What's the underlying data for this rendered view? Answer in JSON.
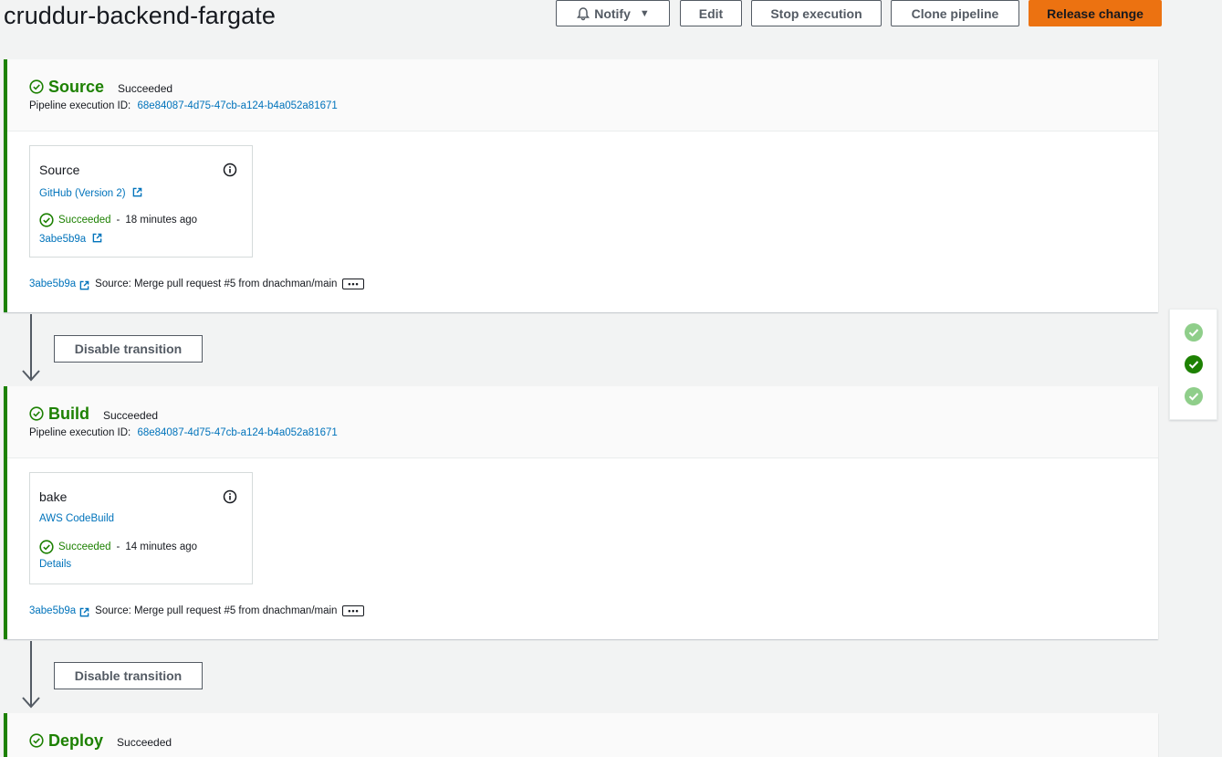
{
  "page": {
    "title": "cruddur-backend-fargate"
  },
  "toolbar": {
    "notify_label": "Notify",
    "edit_label": "Edit",
    "stop_label": "Stop execution",
    "clone_label": "Clone pipeline",
    "release_label": "Release change",
    "accent": "#ec7211"
  },
  "stages": [
    {
      "name": "Source",
      "status": "Succeeded",
      "exec_label": "Pipeline execution ID:",
      "exec_id": "68e84087-4d75-47cb-a124-b4a052a81671",
      "action": {
        "name": "Source",
        "provider": "GitHub (Version 2)",
        "status": "Succeeded",
        "time": "18 minutes ago",
        "link": "3abe5b9a"
      },
      "revision": {
        "id": "3abe5b9a",
        "message": "Source: Merge pull request #5 from dnachman/main"
      }
    },
    {
      "name": "Build",
      "status": "Succeeded",
      "exec_label": "Pipeline execution ID:",
      "exec_id": "68e84087-4d75-47cb-a124-b4a052a81671",
      "action": {
        "name": "bake",
        "provider": "AWS CodeBuild",
        "status": "Succeeded",
        "time": "14 minutes ago",
        "link": "Details"
      },
      "revision": {
        "id": "3abe5b9a",
        "message": "Source: Merge pull request #5 from dnachman/main"
      }
    },
    {
      "name": "Deploy",
      "status": "Succeeded"
    }
  ],
  "transitions": [
    {
      "label": "Disable transition"
    },
    {
      "label": "Disable transition"
    }
  ],
  "colors": {
    "success": "#1d8102",
    "link": "#0073bb",
    "success_light": "#8fce8a"
  }
}
